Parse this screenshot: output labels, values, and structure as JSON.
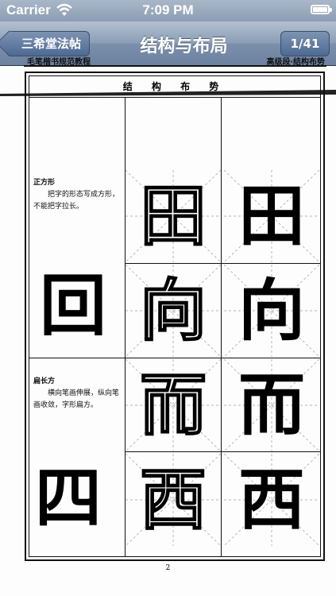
{
  "status_bar": {
    "carrier": "Carrier",
    "time": "7:09 PM",
    "battery_level": 1.0,
    "icons": [
      "wifi-icon",
      "battery-icon"
    ]
  },
  "nav_bar": {
    "back_label": "三希堂法帖",
    "title": "结构与布局",
    "page_indicator": "1/41"
  },
  "page": {
    "header_left": "毛笔楷书规范教程",
    "header_right": "高级段·结构布势",
    "section_title": "结 构 布 势",
    "sections": [
      {
        "heading": "正方形",
        "lines": [
          "把字的形态写成方形，",
          "不能把字拉长。"
        ],
        "example_char": "回",
        "outline_chars": [
          "田",
          "向"
        ],
        "solid_chars": [
          "田",
          "向"
        ]
      },
      {
        "heading": "扁长方",
        "lines": [
          "横向笔画伸展，纵向笔",
          "画收敛，字形扁方。"
        ],
        "example_char": "四",
        "outline_chars": [
          "而",
          "西"
        ],
        "solid_chars": [
          "而",
          "西"
        ]
      }
    ],
    "page_number": "2"
  }
}
